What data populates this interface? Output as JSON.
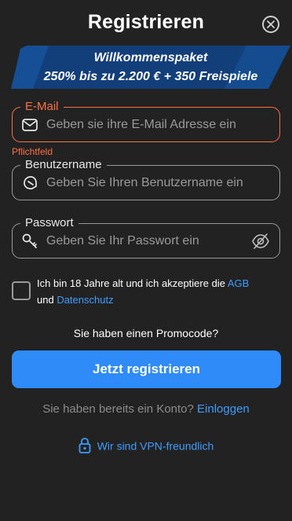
{
  "header": {
    "title": "Registrieren",
    "close_icon": "close-circle-icon"
  },
  "banner": {
    "line1": "Willkommenspaket",
    "line2": "250% bis zu 2.200 € + 350 Freispiele",
    "color": "#123f7a"
  },
  "form": {
    "email": {
      "label": "E-Mail",
      "placeholder": "Geben sie ihre E-Mail Adresse ein",
      "icon": "envelope-icon",
      "error": "Pflichtfeld"
    },
    "username": {
      "label": "Benutzername",
      "placeholder": "Geben Sie Ihren Benutzername ein",
      "icon": "user-badge-icon"
    },
    "password": {
      "label": "Passwort",
      "placeholder": "Geben Sie Ihr Passwort ein",
      "icon": "key-icon",
      "toggle_icon": "eye-off-icon"
    },
    "consent": {
      "text_before": "Ich bin 18 Jahre alt und ich akzeptiere die ",
      "agb_link": "AGB",
      "text_middle": "und ",
      "privacy_link": "Datenschutz"
    },
    "promo_text": "Sie haben einen Promocode?",
    "submit_label": "Jetzt registrieren",
    "login_text": "Sie haben bereits ein Konto? ",
    "login_link": "Einloggen",
    "vpn_text": "Wir sind VPN-freundlich"
  },
  "colors": {
    "accent": "#2f8bf7",
    "link": "#3f9cff",
    "error": "#ff7043",
    "background": "#222222"
  }
}
